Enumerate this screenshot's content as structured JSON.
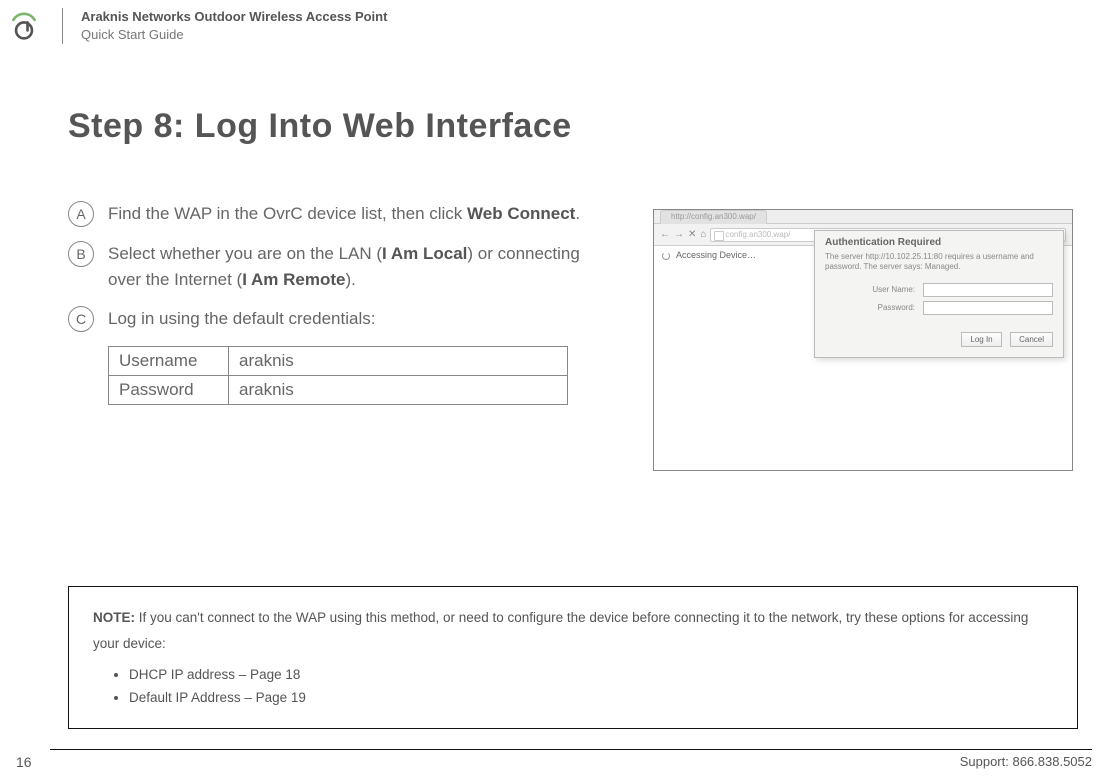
{
  "header": {
    "title_line1": "Araknis Networks Outdoor Wireless Access Point",
    "title_line2": "Quick Start Guide"
  },
  "page_title": "Step 8: Log Into Web Interface",
  "steps": {
    "a": {
      "marker": "A",
      "text_pre": "Find the WAP in the OvrC device list, then click ",
      "bold": "Web Connect",
      "text_post": "."
    },
    "b": {
      "marker": "B",
      "seg1": "Select whether you are on the LAN (",
      "b1": "I Am Local",
      "seg2": ") or connecting over the Internet (",
      "b2": "I Am Remote",
      "seg3": ")."
    },
    "c": {
      "marker": "C",
      "text": "Log in using the default credentials:"
    }
  },
  "credentials": {
    "username_label": "Username",
    "username_value": "araknis",
    "password_label": "Password",
    "password_value": "araknis"
  },
  "browser_mock": {
    "tab_text": "http://config.an300.wap/",
    "nav_back": "←",
    "nav_fwd": "→",
    "nav_reload": "✕",
    "nav_home": "⌂",
    "url_text": "config.an300.wap/",
    "loading_text": "Accessing Device…",
    "auth": {
      "title": "Authentication Required",
      "msg": "The server http://10.102.25.11:80 requires a username and password. The server says: Managed.",
      "user_label": "User Name:",
      "pass_label": "Password:",
      "login_btn": "Log In",
      "cancel_btn": "Cancel"
    }
  },
  "note": {
    "bold": "NOTE:",
    "text": " If you can't connect to the WAP using this method, or need to configure the device before connecting it to the network, try these options for accessing your device:",
    "items": [
      "DHCP IP address – Page 18",
      "Default IP Address – Page 19"
    ]
  },
  "footer": {
    "page": "16",
    "support": "Support: 866.838.5052"
  }
}
